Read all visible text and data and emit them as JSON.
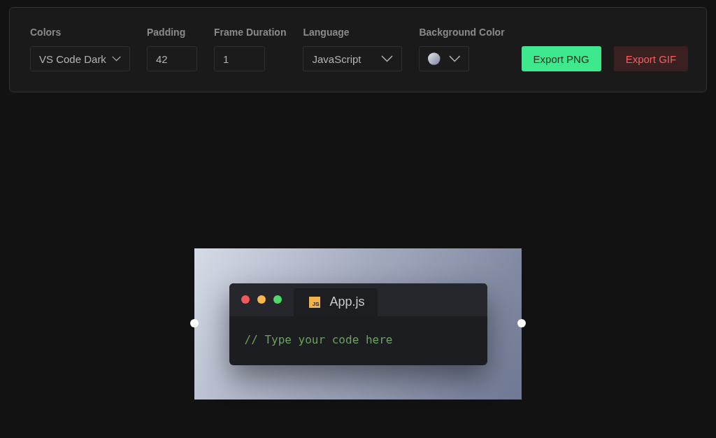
{
  "toolbar": {
    "fields": [
      {
        "kind": "dropdown",
        "label": "Colors",
        "value": "VS Code Dark"
      },
      {
        "kind": "input",
        "label": "Padding",
        "value": "42"
      },
      {
        "kind": "input",
        "label": "Frame Duration",
        "value": "1"
      },
      {
        "kind": "dropdown",
        "label": "Language",
        "value": "JavaScript"
      },
      {
        "kind": "color",
        "label": "Background Color"
      }
    ],
    "buttons": [
      {
        "kind": "primary",
        "label": "Export PNG"
      },
      {
        "kind": "danger",
        "label": "Export GIF"
      }
    ]
  },
  "preview": {
    "window": {
      "tab": {
        "icon_text": "JS",
        "title": "App.js"
      },
      "code": "// Type your code here"
    }
  }
}
